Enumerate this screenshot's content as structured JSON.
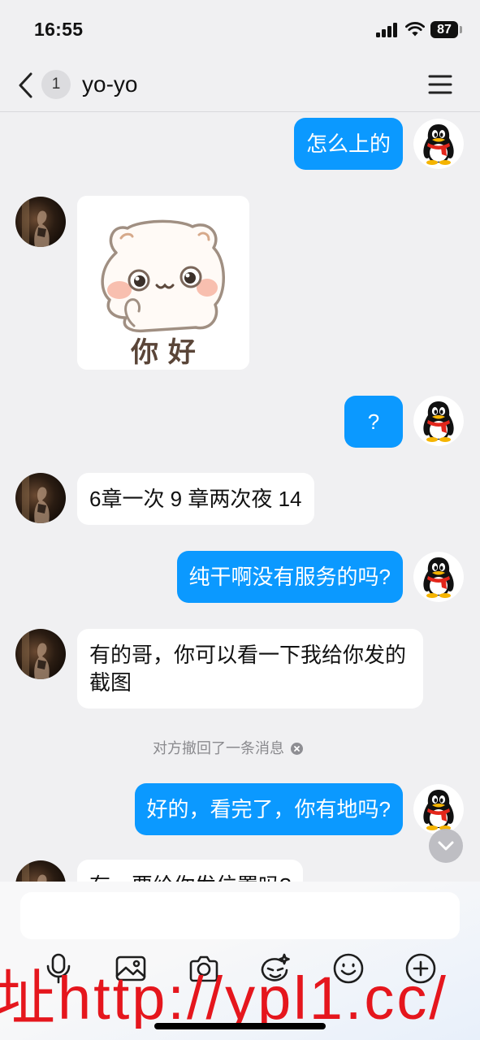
{
  "status_bar": {
    "time": "16:55",
    "battery_level": "87",
    "icons": [
      "signal-icon",
      "wifi-icon",
      "battery-icon"
    ]
  },
  "header": {
    "unread_badge": "1",
    "title": "yo-yo",
    "icons": {
      "back": "chevron-left-icon",
      "menu": "hamburger-menu-icon"
    }
  },
  "avatars": {
    "self": "qq-penguin-avatar",
    "contact": "contact-photo-avatar"
  },
  "messages": [
    {
      "outgoing": true,
      "text": "怎么上的"
    },
    {
      "outgoing": false,
      "sticker_caption": "你 好"
    },
    {
      "outgoing": true,
      "text": "?"
    },
    {
      "outgoing": false,
      "text": "6章一次 9 章两次夜 14"
    },
    {
      "outgoing": true,
      "text": "纯干啊没有服务的吗?"
    },
    {
      "outgoing": false,
      "text": "有的哥，你可以看一下我给你发的截图"
    },
    {
      "recalled_notice": "对方撤回了一条消息"
    },
    {
      "outgoing": true,
      "text": "好的，看完了，你有地吗?"
    },
    {
      "outgoing": false,
      "text": "有，要给你发位置吗?"
    }
  ],
  "scroll_to_bottom_icon": "chevron-down-icon",
  "composer": {
    "input_value": "",
    "tools": [
      "mic-icon",
      "image-icon",
      "camera-icon",
      "magic-expression-icon",
      "emoji-icon",
      "plus-circle-icon"
    ]
  },
  "watermark": {
    "text": "址http://ypl1.cc/"
  },
  "colors": {
    "self_bubble": "#0b99ff",
    "contact_bubble": "#ffffff",
    "chat_background": "#f0f0f2",
    "watermark": "#e5161d"
  }
}
